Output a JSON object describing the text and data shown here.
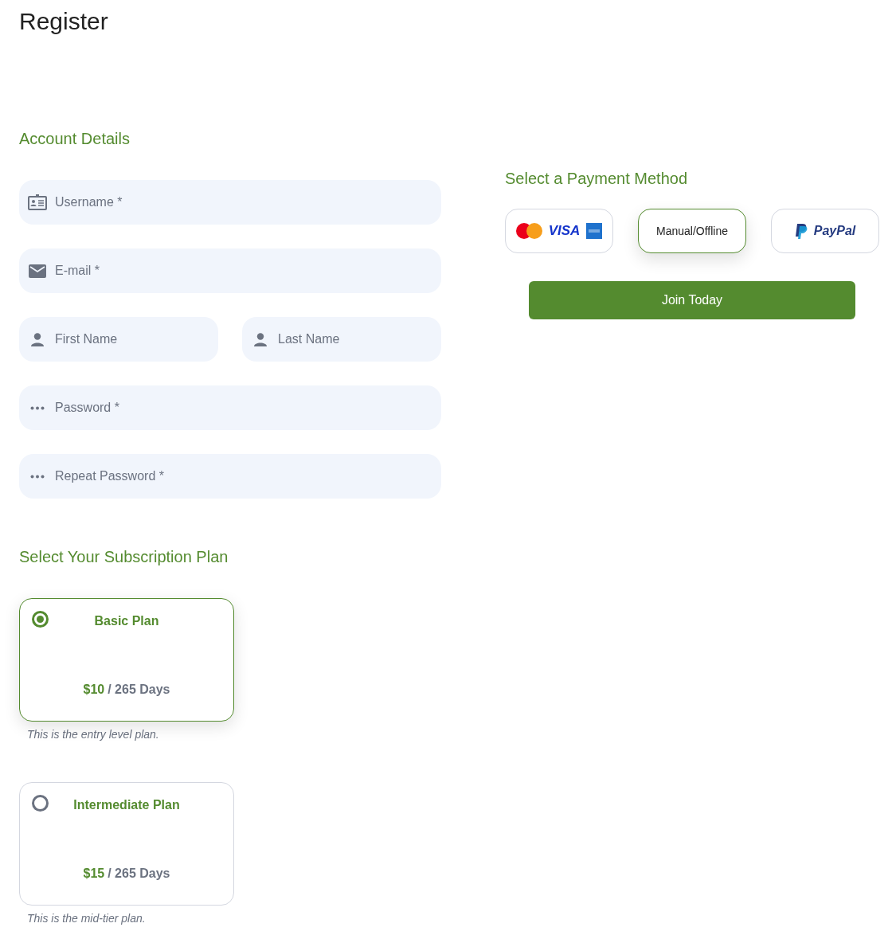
{
  "page_title": "Register",
  "account": {
    "heading": "Account Details",
    "fields": [
      {
        "kind": "id-card",
        "placeholder": "Username *",
        "half": false
      },
      {
        "kind": "mail",
        "placeholder": "E-mail *",
        "half": false
      },
      {
        "kind": "person",
        "placeholder": "First Name",
        "half": true
      },
      {
        "kind": "person",
        "placeholder": "Last Name",
        "half": true
      },
      {
        "kind": "dots",
        "placeholder": "Password *",
        "half": false
      },
      {
        "kind": "dots",
        "placeholder": "Repeat Password *",
        "half": false
      }
    ]
  },
  "plans": {
    "heading": "Select Your Subscription Plan",
    "items": [
      {
        "name": "Basic Plan",
        "price": "$10",
        "period": "/ 265 Days",
        "description": "This is the entry level plan.",
        "selected": true
      },
      {
        "name": "Intermediate Plan",
        "price": "$15",
        "period": "/ 265 Days",
        "description": "This is the mid-tier plan.",
        "selected": false
      }
    ]
  },
  "payment": {
    "heading": "Select a Payment Method",
    "methods": [
      {
        "kind": "cards",
        "label": "VISA",
        "selected": false
      },
      {
        "kind": "text",
        "label": "Manual/Offline",
        "selected": true
      },
      {
        "kind": "paypal",
        "label": "PayPal",
        "selected": false
      }
    ],
    "submit": "Join Today"
  }
}
